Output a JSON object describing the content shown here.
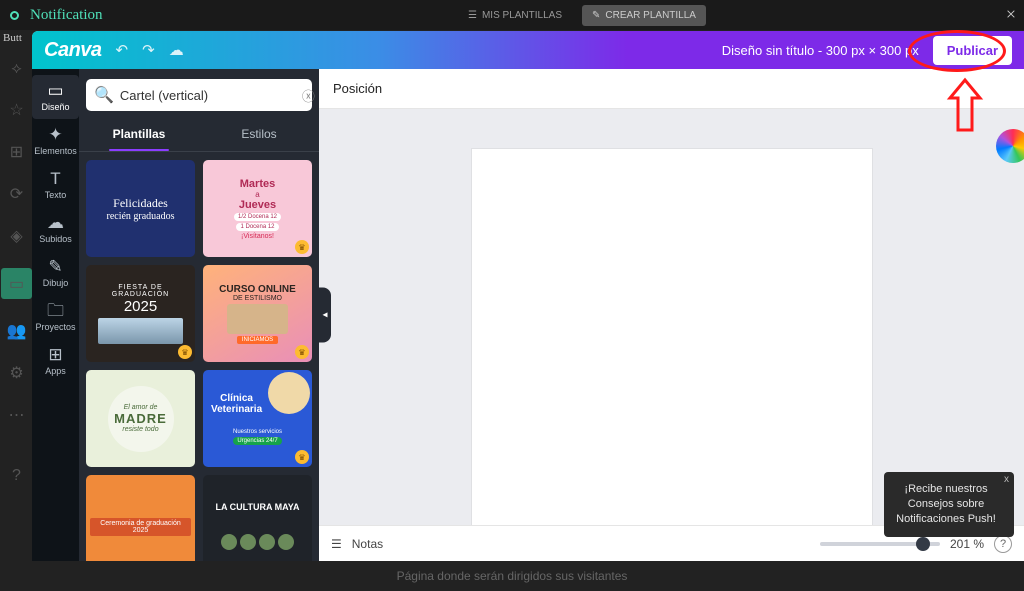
{
  "bg": {
    "title": "Notification",
    "subtitle": "Butt",
    "btn_mis": "MIS PLANTILLAS",
    "btn_crear": "CREAR PLANTILLA",
    "bottom_text": "Página donde serán dirigidos sus visitantes"
  },
  "topbar": {
    "logo": "Canva",
    "title": "Diseño sin título - 300 px × 300 px",
    "publish": "Publicar"
  },
  "sidebar": {
    "items": [
      {
        "icon": "▭",
        "label": "Diseño"
      },
      {
        "icon": "✦",
        "label": "Elementos"
      },
      {
        "icon": "T",
        "label": "Texto"
      },
      {
        "icon": "☁",
        "label": "Subidos"
      },
      {
        "icon": "✎",
        "label": "Dibujo"
      },
      {
        "icon": "🗀",
        "label": "Proyectos"
      },
      {
        "icon": "⊞",
        "label": "Apps"
      }
    ]
  },
  "search": {
    "placeholder": "Cartel (vertical)",
    "value": "Cartel (vertical)",
    "icon": "🔍"
  },
  "panel": {
    "tab_templates": "Plantillas",
    "tab_styles": "Estilos"
  },
  "thumbs": [
    {
      "title1": "Felicidades",
      "title2": "recién graduados"
    },
    {
      "title1": "Martes",
      "title2": "a",
      "title3": "Jueves",
      "l1": "1/2 Docena 12",
      "l2": "1 Docena 12",
      "l3": "¡Visítanos!"
    },
    {
      "title1": "FIESTA DE GRADUACIÓN",
      "title2": "2025"
    },
    {
      "title1": "CURSO ONLINE",
      "title2": "DE ESTILISMO",
      "l1": "INICIAMOS"
    },
    {
      "title1": "El amor de",
      "title2": "MADRE",
      "title3": "resiste todo"
    },
    {
      "title1": "Clínica",
      "title2": "Veterinaria",
      "l1": "Nuestros servicios",
      "l2": "Urgencias 24/7"
    },
    {
      "title1": "Ceremonia de graduación 2025"
    },
    {
      "title1": "LA CULTURA MAYA"
    }
  ],
  "canvas": {
    "position": "Posición",
    "notes": "Notas",
    "zoom": "201 %"
  },
  "tooltip": {
    "l1": "¡Recibe nuestros",
    "l2": "Consejos sobre",
    "l3": "Notificaciones Push!",
    "close": "x"
  }
}
